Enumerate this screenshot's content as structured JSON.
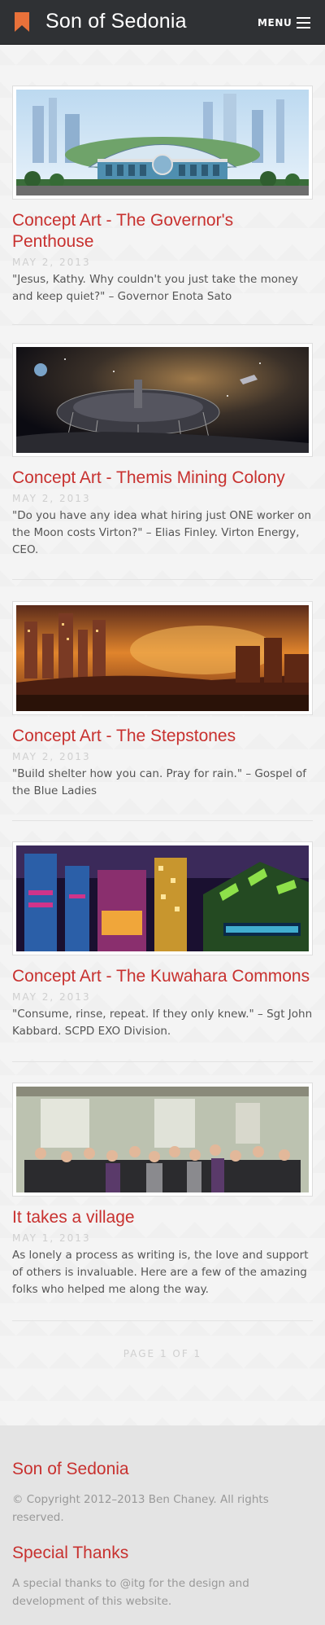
{
  "header": {
    "site_title": "Son of Sedonia",
    "menu_label": "MENU",
    "accent_color": "#e8713a"
  },
  "posts": [
    {
      "title": "Concept Art - The Governor's Penthouse",
      "date": "MAY 2, 2013",
      "excerpt": "\"Jesus, Kathy. Why couldn't you just take the money and keep quiet?\" – Governor Enota Sato"
    },
    {
      "title": "Concept Art - Themis Mining Colony",
      "date": "MAY 2, 2013",
      "excerpt": "\"Do you have any idea what hiring just ONE worker on the Moon costs Virton?\" – Elias Finley. Virton Energy, CEO."
    },
    {
      "title": "Concept Art - The Stepstones",
      "date": "MAY 2, 2013",
      "excerpt": "\"Build shelter how you can. Pray for rain.\" – Gospel of the Blue Ladies"
    },
    {
      "title": "Concept Art - The Kuwahara Commons",
      "date": "MAY 2, 2013",
      "excerpt": "\"Consume, rinse, repeat. If they only knew.\" – Sgt John Kabbard. SCPD EXO Division."
    },
    {
      "title": "It takes a village",
      "date": "MAY 1, 2013",
      "excerpt": "As lonely a process as writing is, the love and support of others is invaluable. Here are a few of the amazing folks who helped me along the way."
    }
  ],
  "pagination": {
    "label": "PAGE 1 OF 1"
  },
  "footer": {
    "title": "Son of Sedonia",
    "copyright": "© Copyright 2012–2013 Ben Chaney. All rights reserved.",
    "thanks_title": "Special Thanks",
    "thanks_text": "A special thanks to @itg for the design and development of this website."
  }
}
